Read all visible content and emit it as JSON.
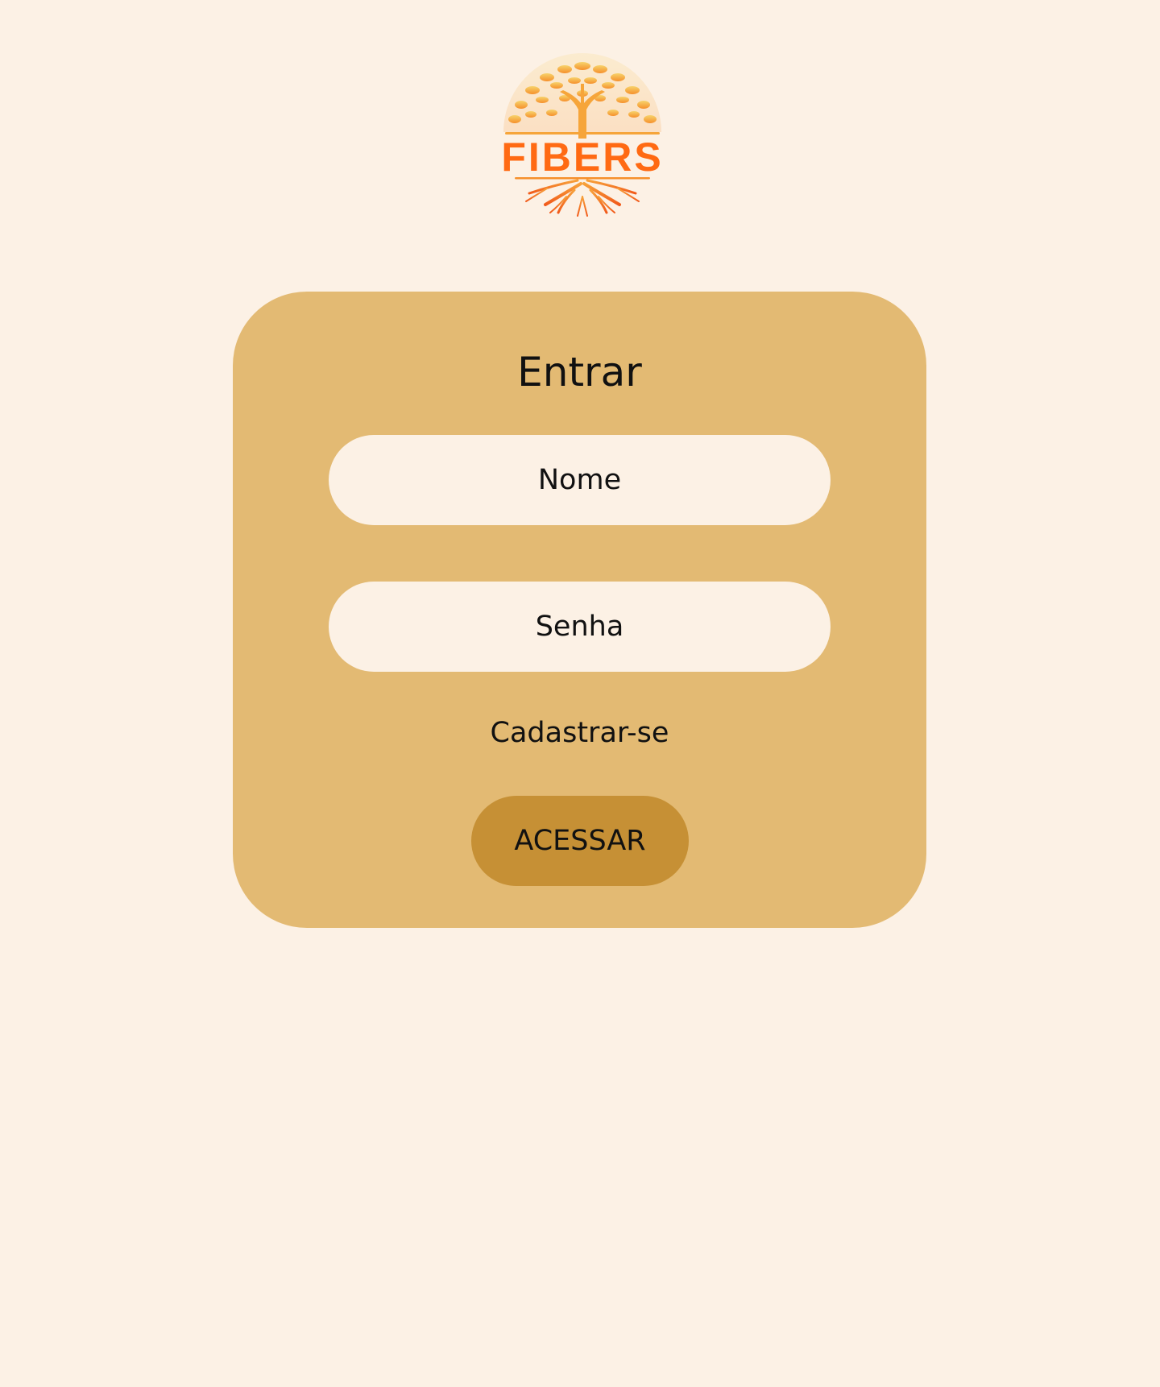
{
  "logo": {
    "text": "FIBERS",
    "icon": "tree-with-roots-icon",
    "colors": {
      "text": "#FF6A13",
      "foliage": "#F7A93A",
      "roots": "#F26A1B"
    }
  },
  "login": {
    "title": "Entrar",
    "name_placeholder": "Nome",
    "password_placeholder": "Senha",
    "register_label": "Cadastrar-se",
    "access_label": "ACESSAR"
  },
  "colors": {
    "page_background": "#FCF1E5",
    "card_background": "#E3BA73",
    "field_background": "#FCF1E5",
    "button_background": "#C69035",
    "text": "#111111"
  }
}
